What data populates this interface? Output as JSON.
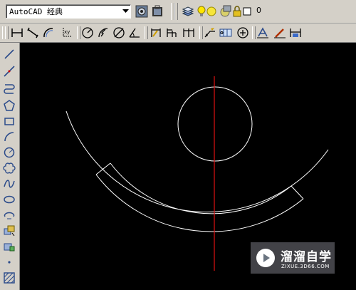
{
  "toolbar_workspace": {
    "workspace_value": "AutoCAD 经典",
    "workspace_dropdown_icon": "chevron-down-icon",
    "workspace_settings_icon": "gear-icon",
    "workspace_lock_icon": "toolbar-lock-icon"
  },
  "toolbar_layers": {
    "layer_manager_icon": "layer-stack-icon",
    "layer_on_icon": "lightbulb-icon",
    "layer_freeze_icon": "sun-icon",
    "layer_viewport_icon": "viewport-freeze-icon",
    "layer_lock_icon": "padlock-icon",
    "layer_color_icon": "color-swatch-icon",
    "current_layer": "0"
  },
  "toolbar_dimension": {
    "items": [
      "linear-dimension-icon",
      "aligned-dimension-icon",
      "arc-length-icon",
      "ordinate-icon",
      "radius-icon",
      "jogged-icon",
      "diameter-icon",
      "angular-icon",
      "quick-dimension-icon",
      "baseline-icon",
      "continue-icon",
      "quick-leader-icon",
      "tolerance-icon",
      "center-mark-icon",
      "dimension-edit-icon",
      "dimension-text-edit-icon",
      "dimension-update-icon"
    ]
  },
  "draw_toolbar": {
    "items": [
      "line-icon",
      "construction-line-icon",
      "polyline-icon",
      "polygon-icon",
      "rectangle-icon",
      "arc-icon",
      "circle-icon",
      "revision-cloud-icon",
      "spline-icon",
      "ellipse-icon",
      "ellipse-arc-icon",
      "insert-block-icon",
      "make-block-icon",
      "point-icon",
      "hatch-icon"
    ]
  },
  "watermark": {
    "title": "溜溜自学",
    "subtitle": "ZIXUE.3D66.COM"
  },
  "colors": {
    "canvas_background": "#000000",
    "geometry": "#ffffff",
    "axis_line": "#ff0000",
    "ui_face": "#d4d0c8"
  }
}
